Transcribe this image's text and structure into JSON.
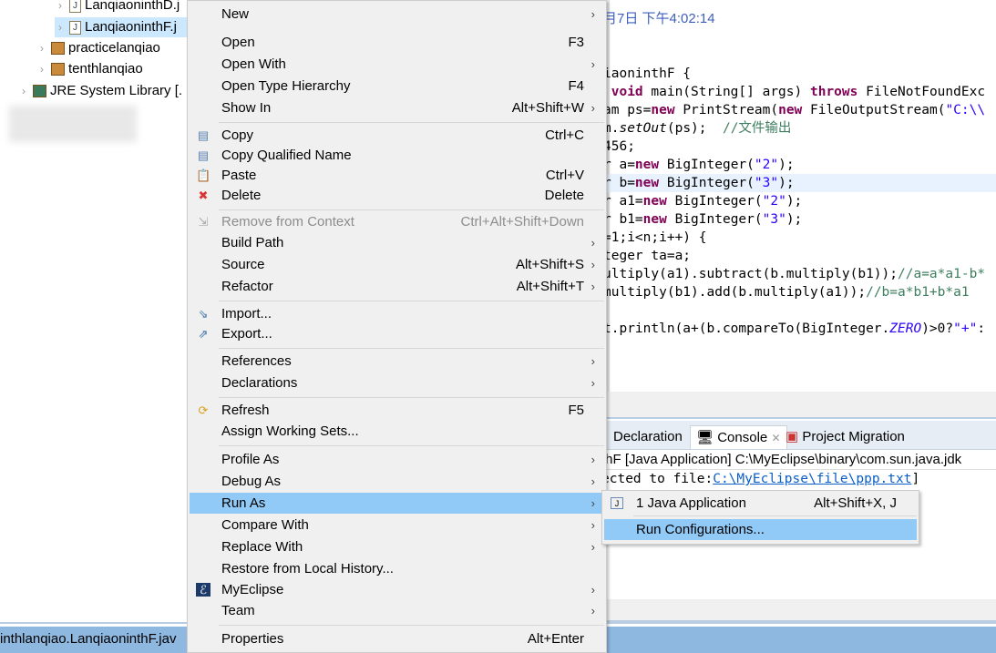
{
  "tree": [
    {
      "label": "LanqiaoninthD.j",
      "type": "java-file"
    },
    {
      "label": "LanqiaoninthF.j",
      "type": "java-file",
      "selected": true
    },
    {
      "label": "practicelanqiao",
      "type": "package"
    },
    {
      "label": "tenthlanqiao",
      "type": "package"
    },
    {
      "label": "JRE System Library [.",
      "type": "library"
    }
  ],
  "editor": {
    "header_date": "月7日 下午4:02:14",
    "lines": [
      "iaoninthF {",
      " void main(String[] args) throws FileNotFoundExc",
      "am ps=new PrintStream(new FileOutputStream(\"C:\\\\",
      "m.setOut(ps);  //文件输出",
      "456;",
      "r a=new BigInteger(\"2\");",
      "r b=new BigInteger(\"3\");",
      "r a1=new BigInteger(\"2\");",
      "r b1=new BigInteger(\"3\");",
      "=1;i<n;i++) {",
      "teger ta=a;",
      "ultiply(a1).subtract(b.multiply(b1));//a=a*a1-b*",
      "multiply(b1).add(b.multiply(a1));//b=a*b1+b*a1",
      "t.println(a+(b.compareTo(BigInteger.ZERO)>0?\"+\":"
    ]
  },
  "bottom_panel": {
    "tabs": [
      {
        "label": "Declaration"
      },
      {
        "label": "Console",
        "active": true
      },
      {
        "label": "Project Migration"
      }
    ],
    "console_header": "thF [Java Application] C:\\MyEclipse\\binary\\com.sun.java.jdk",
    "console_line_prefix": "ected to file:",
    "console_link": "C:\\MyEclipse\\file\\ppp.txt",
    "console_line_suffix": "]"
  },
  "status_bar": {
    "text": "inthlanqiao.LanqiaoninthF.jav"
  },
  "context_menu": {
    "items": [
      {
        "label": "New",
        "submenu": true
      },
      {
        "label": "Open",
        "shortcut": "F3"
      },
      {
        "label": "Open With",
        "submenu": true
      },
      {
        "label": "Open Type Hierarchy",
        "shortcut": "F4"
      },
      {
        "label": "Show In",
        "shortcut": "Alt+Shift+W",
        "submenu": true
      },
      {
        "label": "Copy",
        "shortcut": "Ctrl+C",
        "icon": "copy-icon"
      },
      {
        "label": "Copy Qualified Name",
        "icon": "copy-qualified-name-icon"
      },
      {
        "label": "Paste",
        "shortcut": "Ctrl+V",
        "icon": "paste-icon"
      },
      {
        "label": "Delete",
        "shortcut": "Delete",
        "icon": "delete-icon"
      },
      {
        "label": "Remove from Context",
        "shortcut": "Ctrl+Alt+Shift+Down",
        "disabled": true,
        "icon": "remove-context-icon"
      },
      {
        "label": "Build Path",
        "submenu": true
      },
      {
        "label": "Source",
        "shortcut": "Alt+Shift+S",
        "submenu": true
      },
      {
        "label": "Refactor",
        "shortcut": "Alt+Shift+T",
        "submenu": true
      },
      {
        "label": "Import...",
        "icon": "import-icon"
      },
      {
        "label": "Export...",
        "icon": "export-icon"
      },
      {
        "label": "References",
        "submenu": true
      },
      {
        "label": "Declarations",
        "submenu": true
      },
      {
        "label": "Refresh",
        "shortcut": "F5",
        "icon": "refresh-icon"
      },
      {
        "label": "Assign Working Sets..."
      },
      {
        "label": "Profile As",
        "submenu": true
      },
      {
        "label": "Debug As",
        "submenu": true
      },
      {
        "label": "Run As",
        "submenu": true,
        "highlighted": true
      },
      {
        "label": "Compare With",
        "submenu": true
      },
      {
        "label": "Replace With",
        "submenu": true
      },
      {
        "label": "Restore from Local History..."
      },
      {
        "label": "MyEclipse",
        "submenu": true,
        "icon": "myeclipse-icon"
      },
      {
        "label": "Team",
        "submenu": true
      },
      {
        "label": "Properties",
        "shortcut": "Alt+Enter"
      }
    ]
  },
  "run_as_submenu": {
    "items": [
      {
        "label": "1 Java Application",
        "shortcut": "Alt+Shift+X, J",
        "icon": "java-app-icon"
      },
      {
        "label": "Run Configurations...",
        "highlighted": true
      }
    ]
  },
  "colors": {
    "highlight": "#91c9f7",
    "status_bar": "#8fb8e0",
    "keyword": "#7f0055",
    "string": "#2a00ff",
    "comment": "#3f7f5f"
  }
}
